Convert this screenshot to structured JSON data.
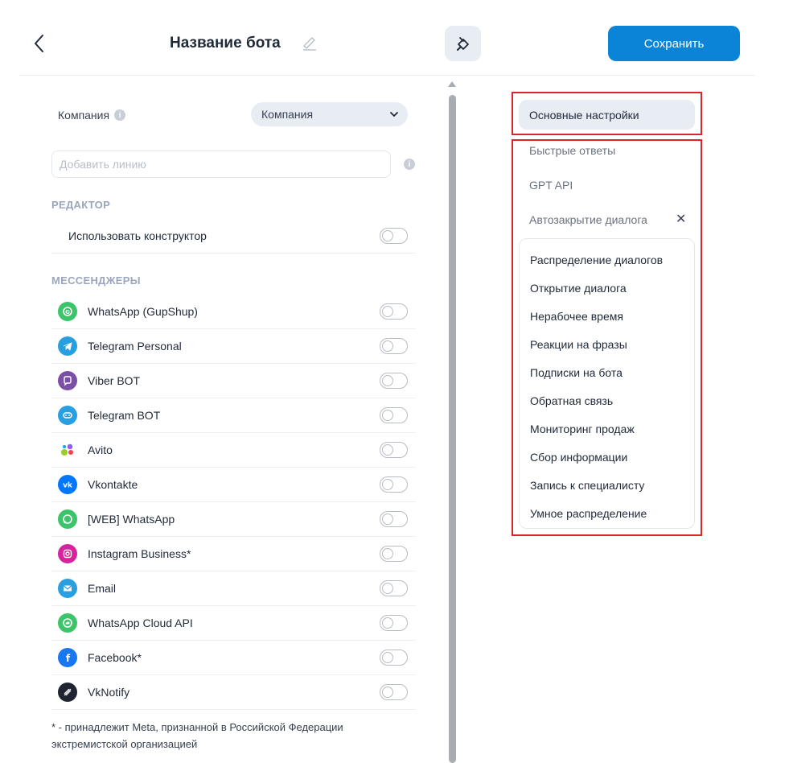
{
  "header": {
    "title": "Название бота",
    "save_label": "Сохранить"
  },
  "company": {
    "label": "Компания",
    "selected": "Компания"
  },
  "line_input": {
    "placeholder": "Добавить линию"
  },
  "editor": {
    "section_title": "РЕДАКТОР",
    "use_constructor_label": "Использовать конструктор",
    "use_constructor_on": false
  },
  "messengers": {
    "section_title": "МЕССЕНДЖЕРЫ",
    "items": [
      {
        "label": "WhatsApp (GupShup)",
        "icon": "whatsapp-gupshup-icon",
        "color": "#3cc46a",
        "enabled": false
      },
      {
        "label": "Telegram Personal",
        "icon": "telegram-icon",
        "color": "#2a9fe0",
        "enabled": false
      },
      {
        "label": "Viber BOT",
        "icon": "viber-icon",
        "color": "#7b4fa6",
        "enabled": false
      },
      {
        "label": "Telegram BOT",
        "icon": "telegram-bot-icon",
        "color": "#2a9fe0",
        "enabled": false
      },
      {
        "label": "Avito",
        "icon": "avito-icon",
        "color": "#00aaff",
        "enabled": false
      },
      {
        "label": "Vkontakte",
        "icon": "vk-icon",
        "color": "#0077ff",
        "enabled": false
      },
      {
        "label": "[WEB] WhatsApp",
        "icon": "whatsapp-icon",
        "color": "#3cc46a",
        "enabled": false
      },
      {
        "label": "Instagram Business*",
        "icon": "instagram-icon",
        "color": "#d6249f",
        "enabled": false
      },
      {
        "label": "Email",
        "icon": "email-icon",
        "color": "#2a9fe0",
        "enabled": false
      },
      {
        "label": "WhatsApp Cloud API",
        "icon": "whatsapp-cloud-icon",
        "color": "#3cc46a",
        "enabled": false
      },
      {
        "label": "Facebook*",
        "icon": "facebook-icon",
        "color": "#1877f2",
        "enabled": false
      },
      {
        "label": "VkNotify",
        "icon": "vknotify-icon",
        "color": "#1f2430",
        "enabled": false
      }
    ]
  },
  "footnote": "* - принадлежит Meta, признанной в Российской Федерации экстремистской организацией",
  "settings_menu": {
    "main": "Основные настройки",
    "plain_items": [
      "Быстрые ответы",
      "GPT API",
      "Автозакрытие диалога"
    ],
    "close_symbol": "✕",
    "dropdown_items": [
      "Распределение диалогов",
      "Открытие диалога",
      "Нерабочее время",
      "Реакции на фразы",
      "Подписки на бота",
      "Обратная связь",
      "Мониторинг продаж",
      "Сбор информации",
      "Запись к специалисту",
      "Умное распределение"
    ]
  },
  "colors": {
    "accent": "#0a84d6",
    "highlight_border": "#d9262c"
  }
}
